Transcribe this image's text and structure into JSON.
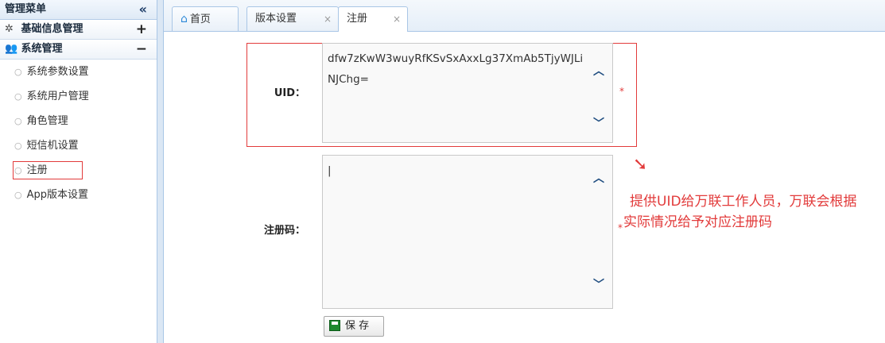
{
  "sidebar": {
    "title": "管理菜单",
    "collapse_glyph": "«",
    "sections": [
      {
        "label": "基础信息管理",
        "icon": "gear-icon",
        "toggle": "+"
      },
      {
        "label": "系统管理",
        "icon": "users-icon",
        "toggle": "−"
      }
    ],
    "items": [
      {
        "label": "系统参数设置"
      },
      {
        "label": "系统用户管理"
      },
      {
        "label": "角色管理"
      },
      {
        "label": "短信机设置"
      },
      {
        "label": "注册"
      },
      {
        "label": "App版本设置"
      }
    ]
  },
  "tabs": [
    {
      "label": "首页",
      "icon": "home-icon"
    },
    {
      "label": "版本设置",
      "close": "×"
    },
    {
      "label": "注册",
      "close": "×"
    }
  ],
  "form": {
    "uid_label": "UID：",
    "uid_value": "dfw7zKwW3wuyRfKSvSxAxxLg37XmAb5TjyWJLiNJChg=",
    "reg_label": "注册码：",
    "reg_value": "|",
    "required_mark": "*",
    "save_label": "保 存"
  },
  "annotation": {
    "line1": "提供UID给万联工作人员，万联会根据",
    "line2": "实际情况给予对应注册码",
    "arrow": "➘",
    "color": "#e23b3b"
  }
}
